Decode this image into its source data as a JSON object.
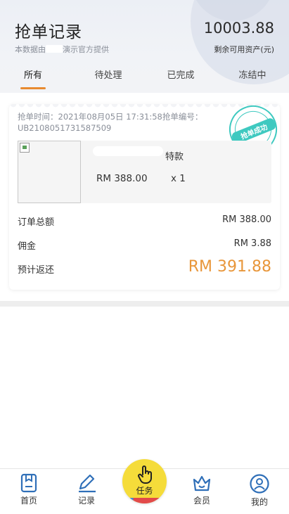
{
  "header": {
    "title": "抢单记录",
    "subtitle_prefix": "本数据由",
    "subtitle_suffix": "演示官方提供",
    "balance": "10003.88",
    "balance_label": "剩余可用资产(元)"
  },
  "tabs": [
    {
      "label": "所有",
      "active": true
    },
    {
      "label": "待处理",
      "active": false
    },
    {
      "label": "已完成",
      "active": false
    },
    {
      "label": "冻结中",
      "active": false
    }
  ],
  "order": {
    "meta_line1": "抢单时间：2021年08月05日 17:31:58抢单编号：",
    "meta_line2": "UB2108051731587509",
    "stamp_text": "抢单成功",
    "product_name_suffix": "特款",
    "price": "RM 388.00",
    "quantity": "x 1",
    "total_label": "订单总额",
    "total_value": "RM 388.00",
    "commission_label": "佣金",
    "commission_value": "RM 3.88",
    "expected_label": "预计返还",
    "expected_value": "RM 391.88"
  },
  "nav": {
    "home": "首页",
    "records": "记录",
    "task": "任务",
    "member": "会员",
    "mine": "我的"
  },
  "colors": {
    "accent": "#e88a2f",
    "stamp": "#3ec9c0",
    "task_button": "#f5dc3a",
    "icon_blue": "#2f6fb8"
  }
}
